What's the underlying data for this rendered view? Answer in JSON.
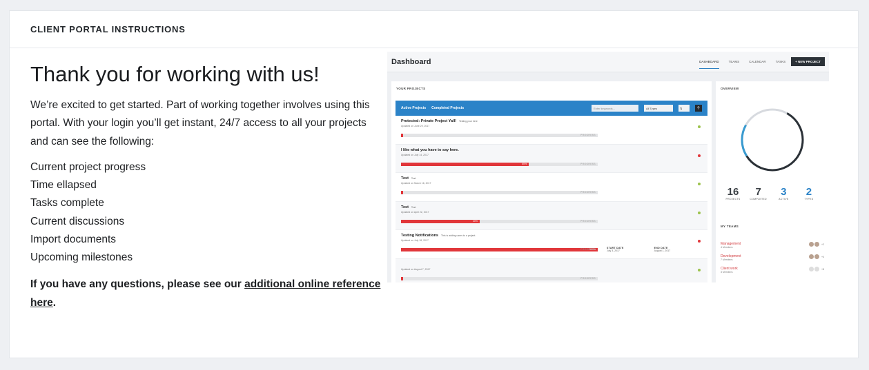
{
  "card": {
    "title": "CLIENT PORTAL INSTRUCTIONS"
  },
  "main": {
    "heading": "Thank you for working with us!",
    "intro": "We’re excited to get started. Part of working together involves using this portal. With your login you’ll get instant, 24/7 access to all your projects and can see the following:",
    "features": [
      "Current project progress",
      "Time ellapsed",
      "Tasks complete",
      "Current discussions",
      "Import documents",
      "Upcoming milestones"
    ],
    "note_prefix": "If you have any questions, please see our ",
    "note_link": "additional online reference here",
    "note_suffix": "."
  },
  "preview": {
    "title": "Dashboard",
    "nav": [
      "DASHBOARD",
      "TEAMS",
      "CALENDAR",
      "TASKS"
    ],
    "new_project": "+ NEW PROJECT",
    "your_projects": "YOUR PROJECTS",
    "tabs": [
      "Active Projects",
      "Completed Projects"
    ],
    "search_placeholder": "Enter keywords...",
    "type_select": "All Types",
    "sort_select": "⇅",
    "rows": [
      {
        "name": "Protected: Private Project Yall!",
        "sub": "Testing your here",
        "updated": "Updated on June 29, 2017",
        "progress": 0,
        "label": "",
        "status_color": "#9bc24b"
      },
      {
        "name": "I like what you have to say here.",
        "sub": "",
        "updated": "Updated on July 14, 2017",
        "progress": 0.65,
        "label": "65%",
        "status_color": "#e1363a"
      },
      {
        "name": "Test",
        "sub": "Test",
        "updated": "Updated on March 16, 2017",
        "progress": 0,
        "label": "",
        "status_color": "#9bc24b"
      },
      {
        "name": "Test",
        "sub": "Test",
        "updated": "Updated on April 22, 2017",
        "progress": 0.4,
        "label": "40%",
        "status_color": "#9bc24b"
      },
      {
        "name": "Testing Notifications",
        "sub": "This is adding users to a project.",
        "updated": "Updated on July 18, 2017",
        "progress": 1,
        "label": "100%",
        "status_color": "#e1363a",
        "start_label": "START DATE",
        "start": "July 3, 2017",
        "end_label": "END DATE",
        "end": "August 1, 2017"
      },
      {
        "name": "",
        "sub": "",
        "updated": "Updated on August 7, 2017",
        "progress": 0,
        "label": "",
        "status_color": "#9bc24b"
      }
    ],
    "progress_tag": "PROGRESS",
    "overview_label": "OVERVIEW",
    "ring": {
      "colors": [
        "#2b3137",
        "#3a9bd0",
        "#d7dadf"
      ]
    },
    "stats": [
      {
        "value": "16",
        "label": "PROJECTS",
        "color": "#3a3f44"
      },
      {
        "value": "7",
        "label": "COMPLETED",
        "color": "#3a3f44"
      },
      {
        "value": "3",
        "label": "ACTIVE",
        "color": "#2b83c8"
      },
      {
        "value": "2",
        "label": "TYPES",
        "color": "#2b83c8"
      }
    ],
    "teams_label": "MY TEAMS",
    "teams": [
      {
        "name": "Management",
        "members": "4 Members",
        "extra": "+2"
      },
      {
        "name": "Development",
        "members": "7 Members",
        "extra": "+4"
      },
      {
        "name": "Client work",
        "members": "3 Members",
        "extra": "+8"
      }
    ]
  }
}
